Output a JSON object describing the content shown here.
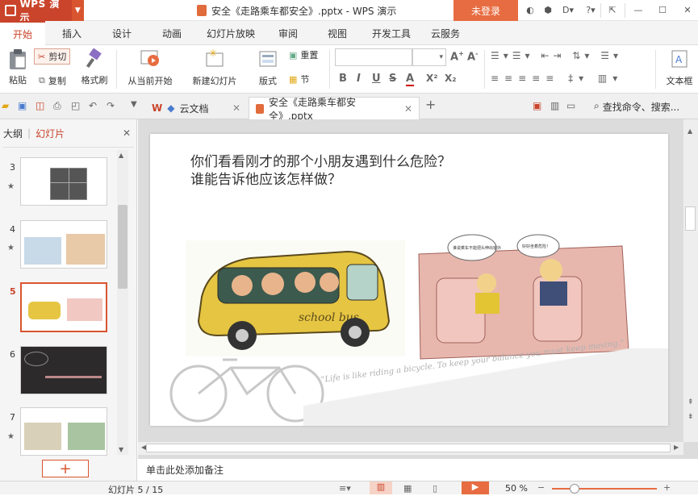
{
  "app": {
    "name": "WPS 演示",
    "title": "安全《走路乘车都安全》.pptx - WPS 演示",
    "login": "未登录"
  },
  "menu": {
    "tabs": [
      "开始",
      "插入",
      "设计",
      "动画",
      "幻灯片放映",
      "审阅",
      "视图",
      "开发工具",
      "云服务"
    ],
    "active": "开始"
  },
  "ribbon": {
    "paste": "粘贴",
    "cut": "剪切",
    "copy": "复制",
    "format_painter": "格式刷",
    "from_current": "从当前开始",
    "new_slide": "新建幻灯片",
    "layout": "版式",
    "reset": "重置",
    "section": "节",
    "textbox": "文本框",
    "format_buttons": [
      "B",
      "I",
      "U",
      "S",
      "A",
      "X²",
      "X₂"
    ]
  },
  "doc_tabs": {
    "cloud_docs": "云文档",
    "active_doc": "安全《走路乘车都安全》.pptx",
    "search": "查找命令、搜索..."
  },
  "left_panel": {
    "tab_outline": "大纲",
    "tab_slides": "幻灯片",
    "slides": [
      {
        "num": "3",
        "star": true
      },
      {
        "num": "4",
        "star": true
      },
      {
        "num": "5",
        "star": false,
        "active": true
      },
      {
        "num": "6",
        "star": false
      },
      {
        "num": "7",
        "star": true
      }
    ]
  },
  "slide": {
    "title_line1": "你们看看刚才的那个小朋友遇到什么危险？",
    "title_line2": "谁能告诉他应该怎样做？",
    "bus_label": "school bus",
    "bubble1": "谁说乘车不能把头伸出窗外",
    "bubble2": "好好坐着危险！",
    "quote": "\"Life is like riding a bicycle. To keep your balance you must keep moving.\""
  },
  "notes_placeholder": "单击此处添加备注",
  "status": {
    "slide_counter": "幻灯片 5 / 15",
    "zoom": "50 %"
  },
  "colors": {
    "accent": "#c9442a",
    "login": "#e76c41"
  }
}
